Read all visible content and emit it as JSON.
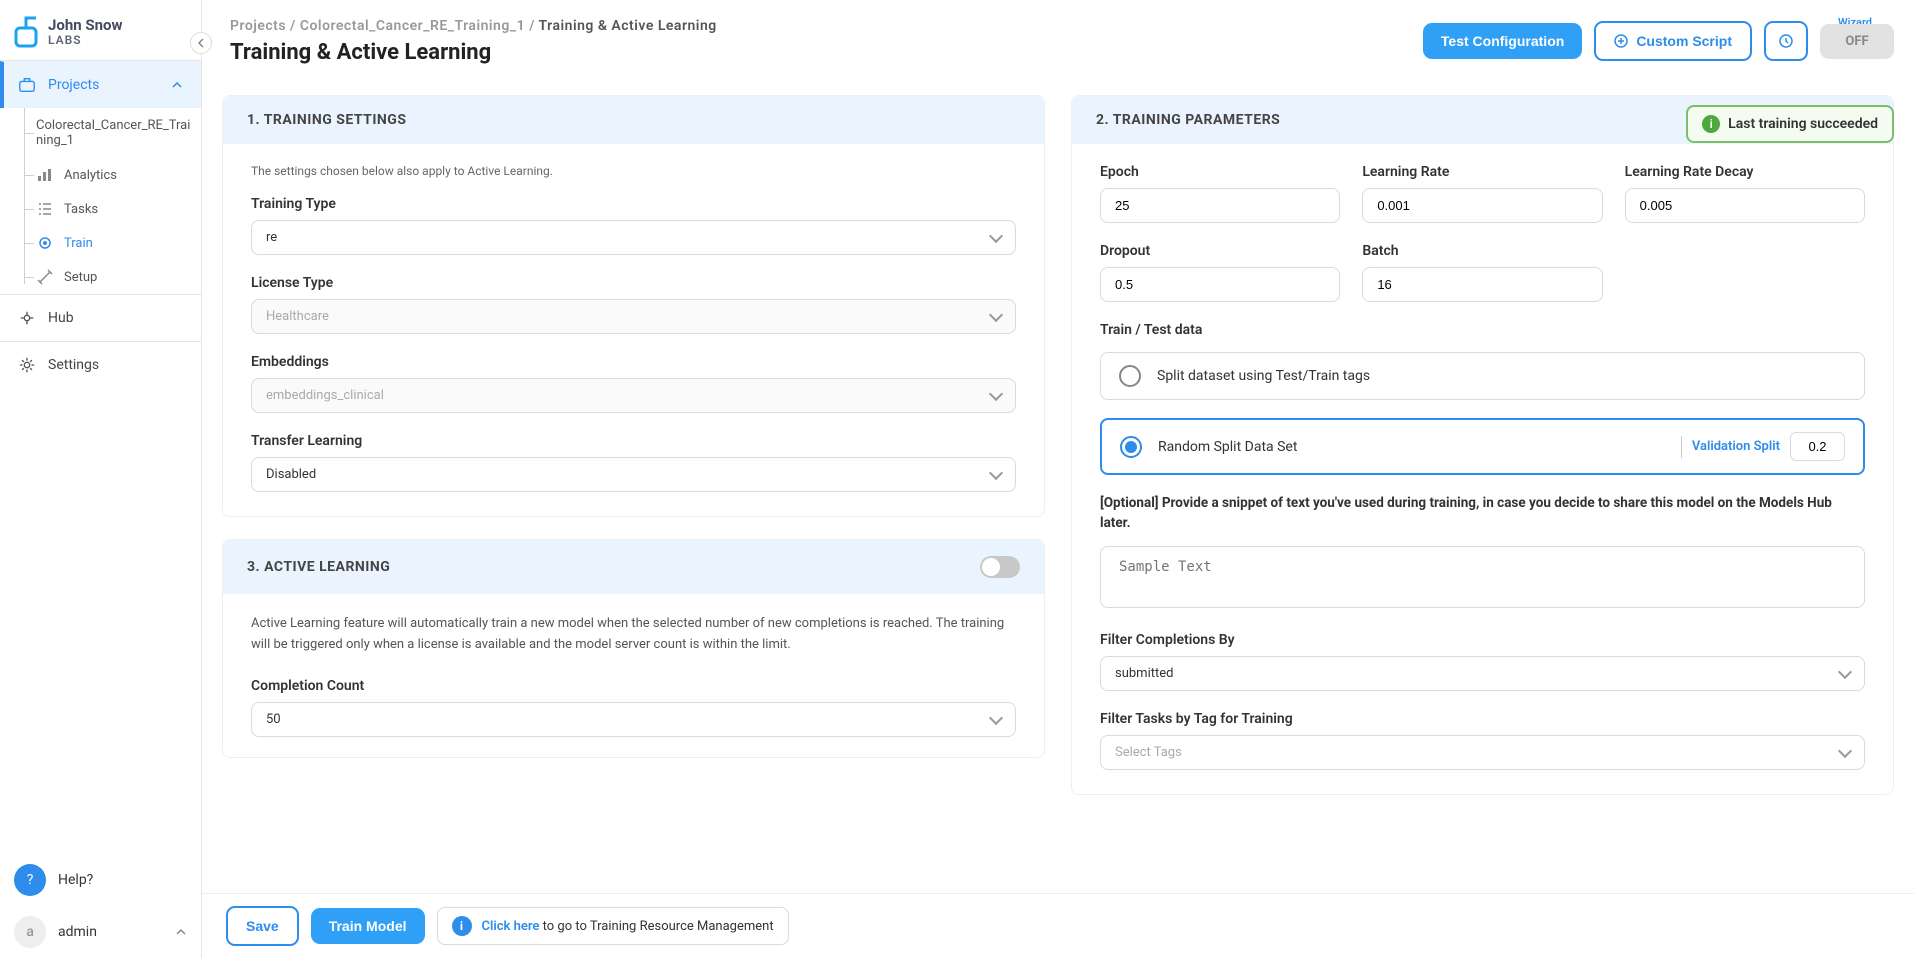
{
  "logo": {
    "line1": "John Snow",
    "line2": "LABS"
  },
  "sidebar": {
    "projects": "Projects",
    "project_name": "Colorectal_Cancer_RE_Training_1",
    "items": [
      "Analytics",
      "Tasks",
      "Train",
      "Setup"
    ],
    "hub": "Hub",
    "settings": "Settings",
    "help": "Help?",
    "user": "admin",
    "user_initial": "a"
  },
  "breadcrumb": {
    "projects": "Projects",
    "project": "Colorectal_Cancer_RE_Training_1",
    "active": "Training & Active Learning"
  },
  "page_title": "Training & Active Learning",
  "header": {
    "test_config": "Test Configuration",
    "custom_script": "Custom Script",
    "wizard": "Wizard",
    "off": "OFF",
    "status": "Last training succeeded"
  },
  "training_settings": {
    "title": "1. TRAINING SETTINGS",
    "hint": "The settings chosen below also apply to Active Learning.",
    "training_type_label": "Training Type",
    "training_type_value": "re",
    "license_type_label": "License Type",
    "license_type_value": "Healthcare",
    "embeddings_label": "Embeddings",
    "embeddings_value": "embeddings_clinical",
    "transfer_learning_label": "Transfer Learning",
    "transfer_learning_value": "Disabled"
  },
  "active_learning": {
    "title": "3. ACTIVE LEARNING",
    "desc": "Active Learning feature will automatically train a new model when the selected number of new completions is reached. The training will be triggered only when a license is available and the model server count is within the limit.",
    "completion_count_label": "Completion Count",
    "completion_count_value": "50"
  },
  "training_params": {
    "title": "2. TRAINING PARAMETERS",
    "epoch_label": "Epoch",
    "epoch_value": "25",
    "lr_label": "Learning Rate",
    "lr_value": "0.001",
    "lrd_label": "Learning Rate Decay",
    "lrd_value": "0.005",
    "dropout_label": "Dropout",
    "dropout_value": "0.5",
    "batch_label": "Batch",
    "batch_value": "16",
    "train_test_label": "Train / Test data",
    "split_option1": "Split dataset using Test/Train tags",
    "split_option2": "Random Split Data Set",
    "validation_split_label": "Validation Split",
    "validation_split_value": "0.2",
    "optional_hint": "[Optional] Provide a snippet of text you've used during training, in case you decide to share this model on the Models Hub later.",
    "sample_text_placeholder": "Sample Text",
    "filter_completions_label": "Filter Completions By",
    "filter_completions_value": "submitted",
    "filter_tags_label": "Filter Tasks by Tag for Training",
    "filter_tags_value": "Select Tags"
  },
  "footer": {
    "save": "Save",
    "train_model": "Train Model",
    "hint_link": "Click here",
    "hint_text": " to go to Training Resource Management"
  }
}
